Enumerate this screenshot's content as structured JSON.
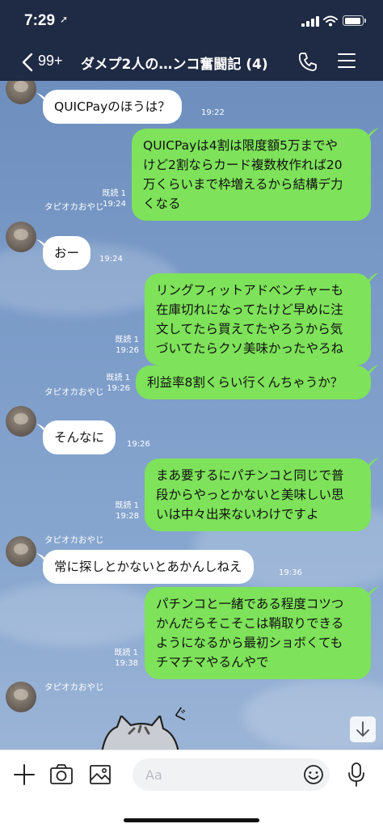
{
  "status": {
    "time": "7:29",
    "location_glyph": "➚"
  },
  "header": {
    "unread_count": "99+",
    "title": "ダメプ2人の…ンコ奮闘記 (4)"
  },
  "chat": {
    "contact": "タピオカおやじ",
    "messages": [
      {
        "dir": "in",
        "text": "QUICPayのほうは？",
        "time": "19:22"
      },
      {
        "dir": "out",
        "text": "QUICPayは4割は限度額5万までや\nけど2割ならカード複数枚作れば20\n万くらいまで枠増えるから結構デ力\nくなる",
        "read": "既読 1",
        "time": "19:24"
      },
      {
        "dir": "in",
        "text": "おー",
        "time": "19:24"
      },
      {
        "dir": "out",
        "text": "リングフィットアドベンチャーも\n在庫切れになってたけど早めに注\n文してたら買えてたやろうから気\nづいてたらクソ美味かったやろね",
        "read": "既読 1",
        "time": "19:26"
      },
      {
        "dir": "out",
        "text": "利益率8割くらい行くんちゃうか？",
        "read": "既読 1",
        "time": "19:26"
      },
      {
        "dir": "in",
        "text": "そんなに",
        "time": "19:26"
      },
      {
        "dir": "out",
        "text": "まあ要するにパチンコと同じで普\n段からやっとかないと美味しい思\nいは中々出来ないわけですよ",
        "read": "既読 1",
        "time": "19:28"
      },
      {
        "dir": "in",
        "text": "常に探しとかないとあかんしねえ",
        "time": "19:36"
      },
      {
        "dir": "out",
        "text": "パチンコと一緒である程度コツつ\nかんだらそこそこは鞘取りできる\nようになるから最初ショボくても\nチマチマやるんやで",
        "read": "既読 1",
        "time": "19:38"
      }
    ]
  },
  "composer": {
    "placeholder": "Aa"
  },
  "colors": {
    "header_bg": "#1f2a44",
    "outgoing_bubble": "#7ee25a",
    "incoming_bubble": "#ffffff"
  }
}
